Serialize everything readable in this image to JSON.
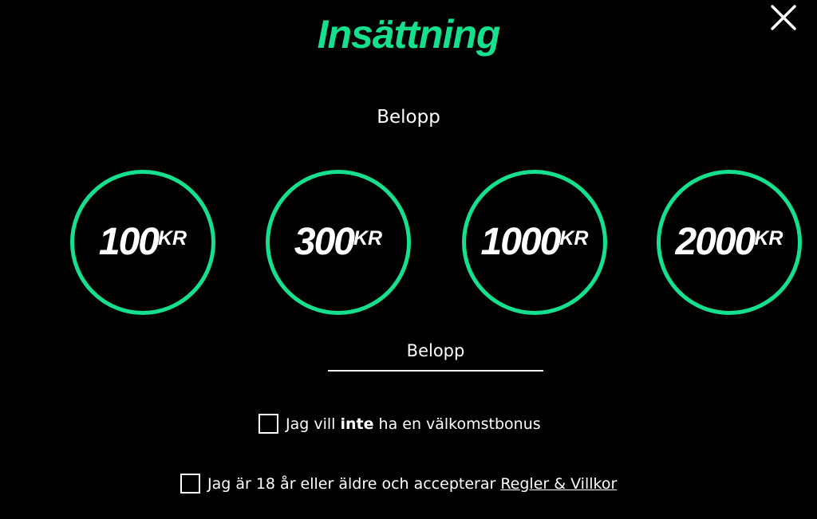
{
  "header": {
    "title": "Insättning"
  },
  "close_icon": "close-icon",
  "amount_section": {
    "label": "Belopp",
    "options": [
      {
        "value": "100",
        "unit": "KR"
      },
      {
        "value": "300",
        "unit": "KR"
      },
      {
        "value": "1000",
        "unit": "KR"
      },
      {
        "value": "2000",
        "unit": "KR"
      }
    ],
    "input": {
      "value": "",
      "placeholder": "Belopp"
    }
  },
  "bonus_checkbox": {
    "checked": false,
    "label_before": "Jag vill ",
    "label_bold": "inte",
    "label_after": " ha en välkomstbonus"
  },
  "terms_checkbox": {
    "checked": false,
    "label": "Jag är 18 år eller äldre och accepterar ",
    "link_text": "Regler & Villkor"
  },
  "colors": {
    "background": "#000000",
    "accent": "#14e08e",
    "text": "#ffffff"
  }
}
